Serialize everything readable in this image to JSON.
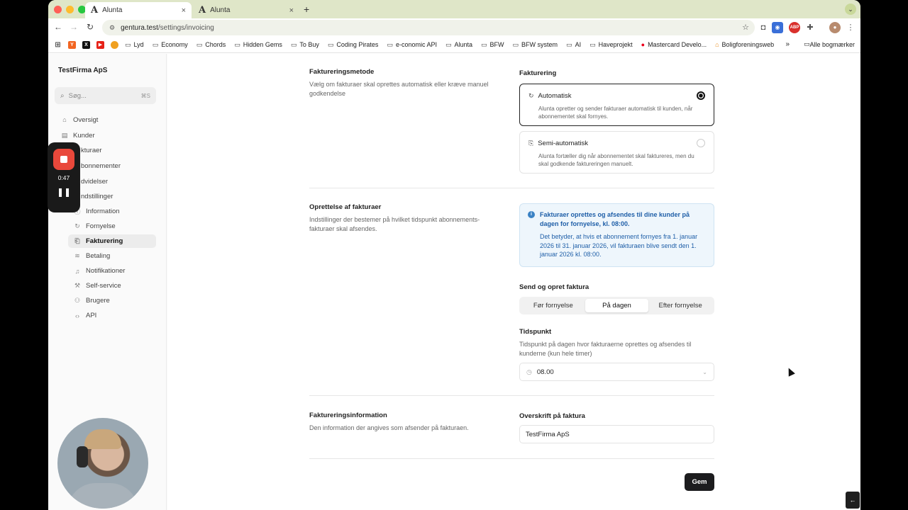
{
  "browser": {
    "tabs": [
      {
        "title": "Alunta",
        "icon": "A"
      },
      {
        "title": "Alunta",
        "icon": "A"
      }
    ],
    "close_glyph": "×",
    "new_tab_glyph": "+",
    "url_host": "gentura.test",
    "url_path": "/settings/invoicing",
    "bookmarks": [
      "Lyd",
      "Economy",
      "Chords",
      "Hidden Gems",
      "To Buy",
      "Coding Pirates",
      "e-conomic API",
      "Alunta",
      "BFW",
      "BFW system",
      "AI",
      "Haveprojekt",
      "Mastercard Develo...",
      "Boligforeningsweb"
    ],
    "bookmarks_all": "Alle bogmærker"
  },
  "sidebar": {
    "company": "TestFirma ApS",
    "search_placeholder": "Søg...",
    "search_shortcut": "⌘S",
    "nav": [
      "Oversigt",
      "Kunder",
      "kturaer",
      "bonnementer",
      "dvidelser",
      "ndstillinger"
    ],
    "sub": [
      "Information",
      "Fornyelse",
      "Fakturering",
      "Betaling",
      "Notifikationer",
      "Self-service",
      "Brugere",
      "API"
    ],
    "active_sub": "Fakturering"
  },
  "sections": {
    "method": {
      "title": "Faktureringsmetode",
      "desc": "Vælg om fakturaer skal oprettes automatisk eller kræve manuel godkendelse",
      "label": "Fakturering",
      "options": [
        {
          "title": "Automatisk",
          "desc": "Alunta opretter og sender fakturaer automatisk til kunden, når abonnementet skal fornyes.",
          "selected": true
        },
        {
          "title": "Semi-automatisk",
          "desc": "Alunta fortæller dig når abonnementet skal faktureres, men du skal godkende faktureringen manuelt.",
          "selected": false
        }
      ]
    },
    "creation": {
      "title": "Oprettelse af fakturaer",
      "desc": "Indstillinger der bestemer på hvilket tidspunkt abonnements-fakturaer skal afsendes.",
      "info_title": "Fakturaer oprettes og afsendes til dine kunder på dagen for fornyelse, kl. 08:00.",
      "info_body": "Det betyder, at hvis et abonnement fornyes fra 1. januar 2026 til 31. januar 2026, vil fakturaen blive sendt den 1. januar 2026 kl. 08:00.",
      "send_label": "Send og opret faktura",
      "segments": [
        "Før fornyelse",
        "På dagen",
        "Efter fornyelse"
      ],
      "active_segment": "På dagen",
      "time_label": "Tidspunkt",
      "time_desc": "Tidspunkt på dagen hvor fakturaerne oprettes og afsendes til kunderne (kun hele timer)",
      "time_value": "08.00"
    },
    "info": {
      "title": "Faktureringsinformation",
      "desc": "Den information der angives som afsender på fakturaen.",
      "heading_label": "Overskrift på faktura",
      "heading_value": "TestFirma ApS"
    }
  },
  "save_label": "Gem",
  "recorder": {
    "time": "0:47"
  },
  "colors": {
    "accent": "#1c1c1e",
    "info_bg": "#eef6fc",
    "info_text": "#1f5fa8",
    "record": "#e9483b"
  }
}
